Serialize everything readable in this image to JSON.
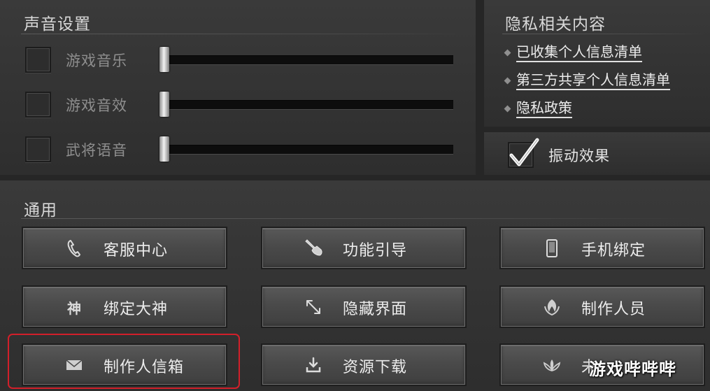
{
  "sound_settings": {
    "title": "声音设置",
    "rows": [
      {
        "label": "游戏音乐",
        "checked": false,
        "level": 0
      },
      {
        "label": "游戏音效",
        "checked": false,
        "level": 0
      },
      {
        "label": "武将语音",
        "checked": false,
        "level": 0
      }
    ]
  },
  "privacy": {
    "title": "隐私相关内容",
    "links": [
      "已收集个人信息清单",
      "第三方共享个人信息清单",
      "隐私政策"
    ]
  },
  "vibration": {
    "label": "振动效果",
    "checked": true
  },
  "general": {
    "title": "通用",
    "buttons": [
      {
        "label": "客服中心",
        "icon": "phone-icon"
      },
      {
        "label": "功能引导",
        "icon": "pointing-hand-icon"
      },
      {
        "label": "手机绑定",
        "icon": "mobile-phone-icon"
      },
      {
        "label": "绑定大神",
        "icon": "shen-glyph-icon",
        "icon_glyph": "神"
      },
      {
        "label": "隐藏界面",
        "icon": "resize-arrows-icon"
      },
      {
        "label": "制作人员",
        "icon": "leaf-emblem-icon"
      },
      {
        "label": "制作人信箱",
        "icon": "envelope-icon"
      },
      {
        "label": "资源下载",
        "icon": "download-icon"
      },
      {
        "label": "未",
        "icon": "lotus-icon"
      }
    ]
  },
  "overlay": {
    "watermark": "游戏哔哔哔",
    "highlight_color": "#d21f2a"
  }
}
